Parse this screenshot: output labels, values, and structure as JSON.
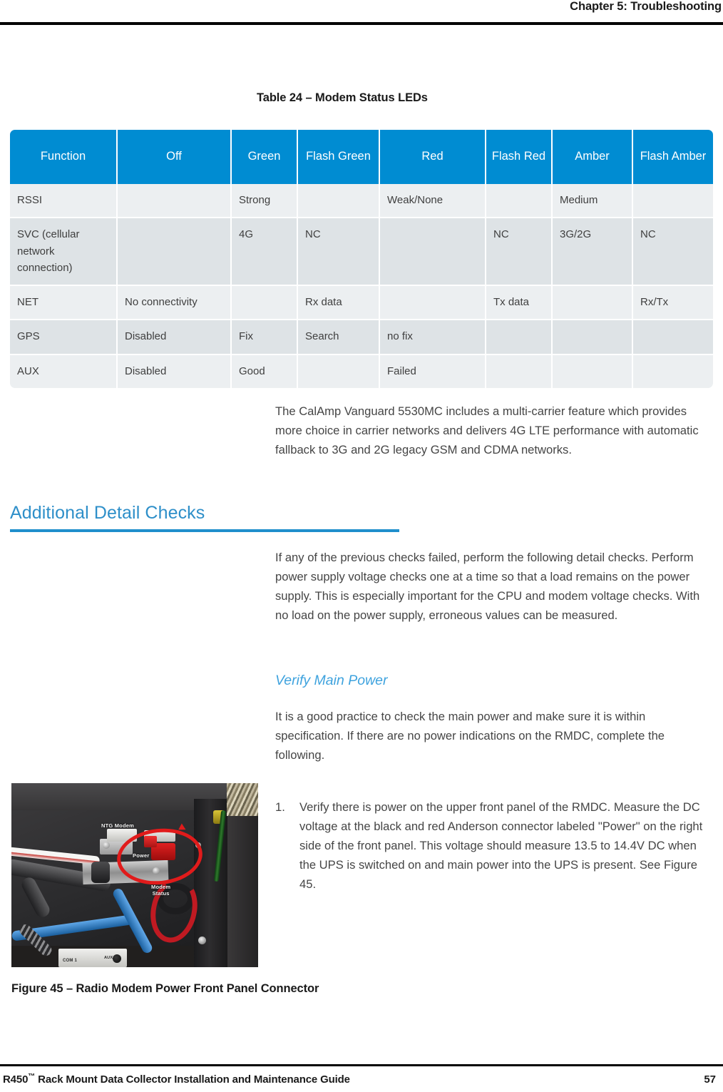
{
  "page": {
    "running_header": "Chapter 5: Troubleshooting",
    "footer_left_main": "R450",
    "footer_left_tm": "™",
    "footer_left_rest": " Rack Mount Data Collector Installation and Maintenance Guide",
    "footer_page_number": "57"
  },
  "colors": {
    "table_header_blue": "#008CD2",
    "heading_blue": "#2E8FC9",
    "heading_rule_blue": "#1F8FCC",
    "subheading_blue": "#3FA3DE",
    "row_light": "#ECEFF1",
    "row_dark": "#DEE3E6",
    "body_text": "#454545",
    "annotation_red": "#E11B1B"
  },
  "table": {
    "caption": "Table 24  –  Modem Status LEDs",
    "columns": [
      "Function",
      "Off",
      "Green",
      "Flash Green",
      "Red",
      "Flash Red",
      "Amber",
      "Flash Amber"
    ],
    "rows": [
      {
        "function": "RSSI",
        "off": "",
        "green": "Strong",
        "flash_green": "",
        "red": "Weak/None",
        "flash_red": "",
        "amber": "Medium",
        "flash_amber": ""
      },
      {
        "function": "SVC (cellular network connection)",
        "off": "",
        "green": "4G",
        "flash_green": "NC",
        "red": "",
        "flash_red": "NC",
        "amber": "3G/2G",
        "flash_amber": "NC"
      },
      {
        "function": "NET",
        "off": "No connectivity",
        "green": "",
        "flash_green": "Rx data",
        "red": "",
        "flash_red": "Tx data",
        "amber": "",
        "flash_amber": "Rx/Tx"
      },
      {
        "function": "GPS",
        "off": "Disabled",
        "green": "Fix",
        "flash_green": "Search",
        "red": "no fix",
        "flash_red": "",
        "amber": "",
        "flash_amber": ""
      },
      {
        "function": "AUX",
        "off": "Disabled",
        "green": "Good",
        "flash_green": "",
        "red": "Failed",
        "flash_red": "",
        "amber": "",
        "flash_amber": ""
      }
    ]
  },
  "body": {
    "intro_paragraph": "The CalAmp Vanguard 5530MC includes a multi-carrier feature which provides more choice in carrier networks and delivers 4G LTE performance with automatic fallback to 3G and 2G legacy GSM and CDMA networks.",
    "section_heading": "Additional Detail Checks",
    "detail_paragraph": "If any of the previous checks failed, perform the following detail checks. Perform power supply voltage checks one at a time so that a load remains on the power supply. This is especially important for the CPU and modem voltage checks. With no load on the power supply, erroneous values can be measured.",
    "sub_heading": "Verify Main Power",
    "main_power_paragraph": "It is a good practice to check the main power and make sure it is within specification. If there are no power indications on the RMDC, complete the following.",
    "list": [
      {
        "number": "1.",
        "text": "Verify there is power on the upper front panel of the RMDC. Measure the DC voltage at the black and red Anderson connector labeled \"Power\" on the right side of the front panel. This voltage should measure 13.5 to 14.4V DC when the UPS is switched on and main power into the UPS is present. See Figure 45."
      }
    ]
  },
  "figure": {
    "caption": "Figure 45  –  Radio Modem Power Front Panel Connector",
    "photo_labels": {
      "ntg_modem": "NTG Modem",
      "power": "Power",
      "modem_status": "Modem\nStatus",
      "com1": "COM 1",
      "aux": "AUX"
    }
  }
}
